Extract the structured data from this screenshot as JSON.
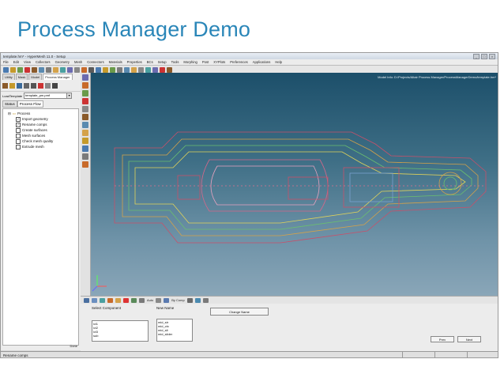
{
  "slide": {
    "title": "Process Manager Demo"
  },
  "app": {
    "window_title": "template.hm* - HyperMesh 11.0 - Setup",
    "menu": [
      "File",
      "Edit",
      "View",
      "Collectors",
      "Geometry",
      "Mesh",
      "Connectors",
      "Materials",
      "Properties",
      "BCs",
      "Setup",
      "Tools",
      "Morphing",
      "Post",
      "XYPlots",
      "Preferences",
      "Applications",
      "Help"
    ],
    "left_tabs": [
      "Utility",
      "Mask",
      "Model",
      "Process Manager"
    ],
    "template_label": "LoadTemplate",
    "template_value": "template_pm.pmf",
    "pm_tabs": [
      "Status",
      "Process Flow"
    ],
    "tree": {
      "root": "Process",
      "steps": [
        {
          "label": "Import geometry",
          "checked": true
        },
        {
          "label": "Rename comps",
          "checked": true
        },
        {
          "label": "Create surfaces",
          "checked": false
        },
        {
          "label": "Mesh surfaces",
          "checked": false
        },
        {
          "label": "Check mesh quality",
          "checked": false
        },
        {
          "label": "Extrude mesh",
          "checked": false
        }
      ]
    },
    "left_footer": "Done",
    "model_info": "Model Info: D:/Projects/Altair Process Manager/ProcessManagerDemo/template.hm*",
    "bottom_toolbar": {
      "auto_label": "Auto",
      "bycomp_label": "By Comp"
    },
    "panel": {
      "select_component_label": "Select Component",
      "new_name_label": "New Name",
      "components": [
        "lvl1",
        "lvl2",
        "lvl3",
        "sub"
      ],
      "new_names": [
        "mid_str",
        "mid_ctx",
        "mid_slt",
        "mid_slider"
      ],
      "change_name_button": "Change Name",
      "prev_button": "Prev",
      "next_button": "Next"
    },
    "status_text": "Rename comps"
  }
}
